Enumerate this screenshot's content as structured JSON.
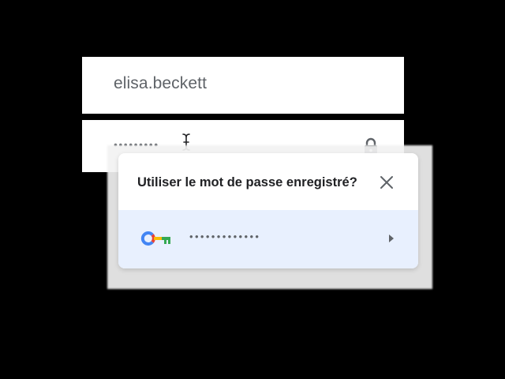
{
  "username_field": {
    "value": "elisa.beckett"
  },
  "password_field": {
    "value": "•••••••••",
    "icon": "lock-icon"
  },
  "popup": {
    "title": "Utiliser le mot de passe enregistré?",
    "close_icon": "close-icon",
    "suggestion": {
      "masked_password": "•••••••••••••",
      "key_icon": "key-icon",
      "chevron_icon": "chevron-right-icon"
    }
  },
  "colors": {
    "background": "#000000",
    "field_background": "#ffffff",
    "text_secondary": "#5f6368",
    "text_primary": "#202124",
    "suggestion_highlight": "#e8f0fe",
    "google_blue": "#4285f4",
    "google_red": "#ea4335",
    "google_yellow": "#fbbc05",
    "google_green": "#34a853"
  }
}
